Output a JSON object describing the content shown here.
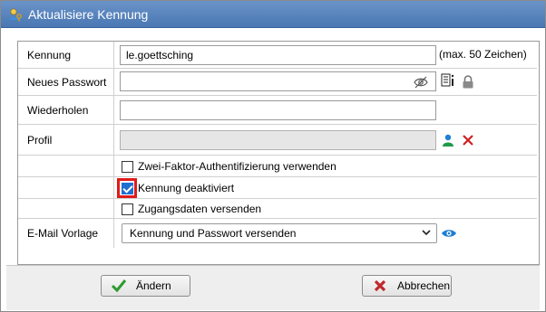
{
  "window": {
    "title": "Aktualisiere Kennung"
  },
  "form": {
    "kennung": {
      "label": "Kennung",
      "value": "le.goettsching",
      "hint": "(max. 50 Zeichen)"
    },
    "neues_passwort": {
      "label": "Neues Passwort",
      "value": ""
    },
    "wiederholen": {
      "label": "Wiederholen",
      "value": ""
    },
    "profil": {
      "label": "Profil",
      "value": ""
    },
    "checkboxes": [
      {
        "label": "Zwei-Faktor-Authentifizierung verwenden",
        "checked": false
      },
      {
        "label": "Kennung deaktiviert",
        "checked": true
      },
      {
        "label": "Zugangsdaten versenden",
        "checked": false
      }
    ],
    "email_vorlage": {
      "label": "E-Mail Vorlage",
      "selected": "Kennung und Passwort versenden"
    }
  },
  "footer": {
    "aendern_label": "Ändern",
    "abbrechen_label": "Abbrechen"
  },
  "colors": {
    "titlebar": "#5a86c0",
    "highlight": "#e01a1a",
    "check": "#1f6fd1",
    "ok_green": "#2e9a2e",
    "cancel_red": "#c0282d"
  }
}
